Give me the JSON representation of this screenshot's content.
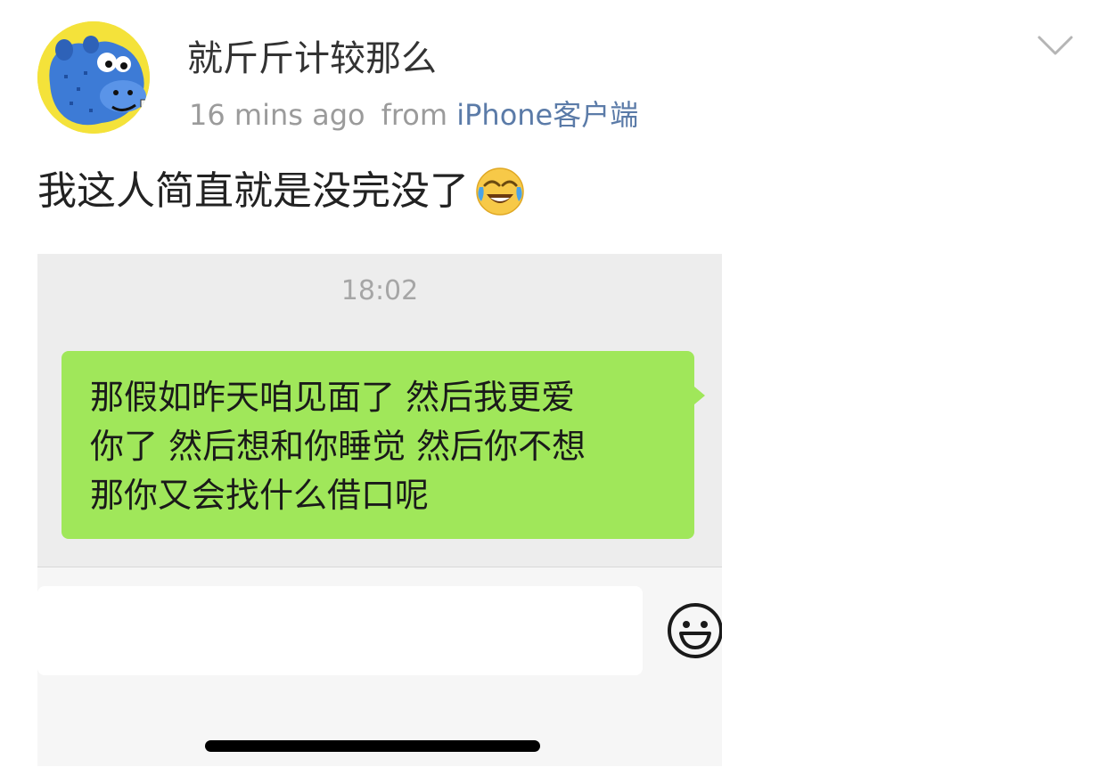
{
  "post": {
    "username": "就斤斤计较那么",
    "time": "16 mins ago",
    "from_label": "from",
    "source": "iPhone客户端",
    "text": "我这人简直就是没完没了",
    "emoji": "laughing-crying-emoji"
  },
  "chat": {
    "time": "18:02",
    "message_lines": [
      "那假如昨天咱见面了 然后我更爱",
      "你了 然后想和你睡觉 然后你不想",
      "那你又会找什么借口呢"
    ],
    "input_placeholder": ""
  },
  "colors": {
    "source_link": "#5b7ba8",
    "bubble": "#a0e75a",
    "avatar_bg": "#f4e23a"
  }
}
